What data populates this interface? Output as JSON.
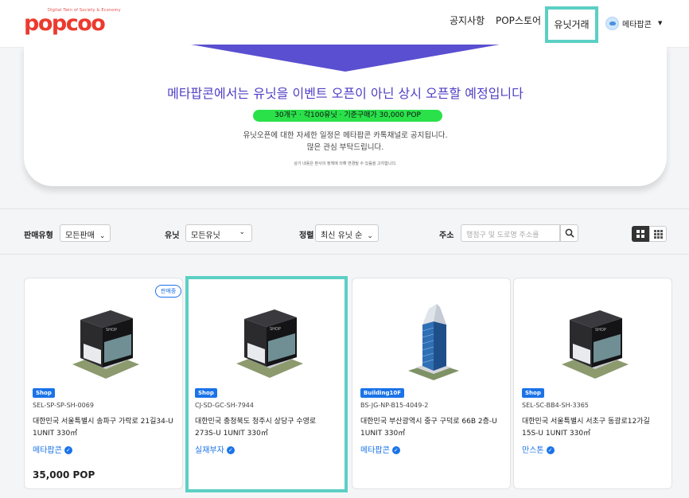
{
  "header": {
    "logo_text": "popcoo",
    "logo_tagline": "Digital Twin of Society & Economy",
    "nav": {
      "notice": "공지사항",
      "store": "POP스토어",
      "unit_trade": "유닛거래"
    },
    "user": {
      "name": "메타팝콘"
    }
  },
  "banner": {
    "title": "메타팝콘에서는 유닛을 이벤트 오픈이 아닌 상시 오픈할 예정입니다",
    "pill": "30개구 · 각100유닛 · 기준구매가 30,000 POP",
    "line1": "유닛오픈에 대한 자세한 일정은 메타팝콘 카톡채널로 공지됩니다.",
    "line2": "많은 관심 부탁드립니다.",
    "small": "상기 내용은 본사의 정책에 의해 변경될 수 있음을 고지합니다.",
    "colors": {
      "title": "#4f3fc4",
      "pill": "#2ae14a",
      "triangle": "#5a4fd0"
    }
  },
  "filters": {
    "sale_type": {
      "label": "판매유형",
      "value": "모든판매"
    },
    "unit": {
      "label": "유닛",
      "value": "모든유닛"
    },
    "sort": {
      "label": "정렬",
      "value": "최신 유닛 순"
    },
    "address": {
      "label": "주소",
      "placeholder": "행정구 및 도로명 주소를"
    }
  },
  "cards": [
    {
      "badge": "Shop",
      "code": "SEL-SP-SP-SH-0069",
      "address": "대한민국 서울특별시 송파구 가락로 21길34-U 1UNIT 330㎡",
      "owner": "메타팝콘",
      "price": "35,000 POP",
      "sale_tag": "판매중",
      "image": "shop-building"
    },
    {
      "badge": "Shop",
      "code": "CJ-SD-GC-SH-7944",
      "address": "대한민국 충청북도 청주시 상당구 수영로 273S-U 1UNIT 330㎡",
      "owner": "실재부자",
      "price": "",
      "sale_tag": "",
      "image": "shop-building"
    },
    {
      "badge": "Building10F",
      "code": "BS-JG-NP-B15-4049-2",
      "address": "대한민국 부산광역시 중구 구덕로 66B 2층-U 1UNIT 330㎡",
      "owner": "메타팝콘",
      "price": "",
      "sale_tag": "",
      "image": "tower-building"
    },
    {
      "badge": "Shop",
      "code": "SEL-SC-BB4-SH-3365",
      "address": "대한민국 서울특별시 서초구 동광로12가길 15S-U 1UNIT 330㎡",
      "owner": "만스톤",
      "price": "",
      "sale_tag": "",
      "image": "shop-building"
    }
  ],
  "colors": {
    "accent": "#1a73e8",
    "highlight": "#5ccfc4",
    "brand": "#ec3a2e"
  }
}
